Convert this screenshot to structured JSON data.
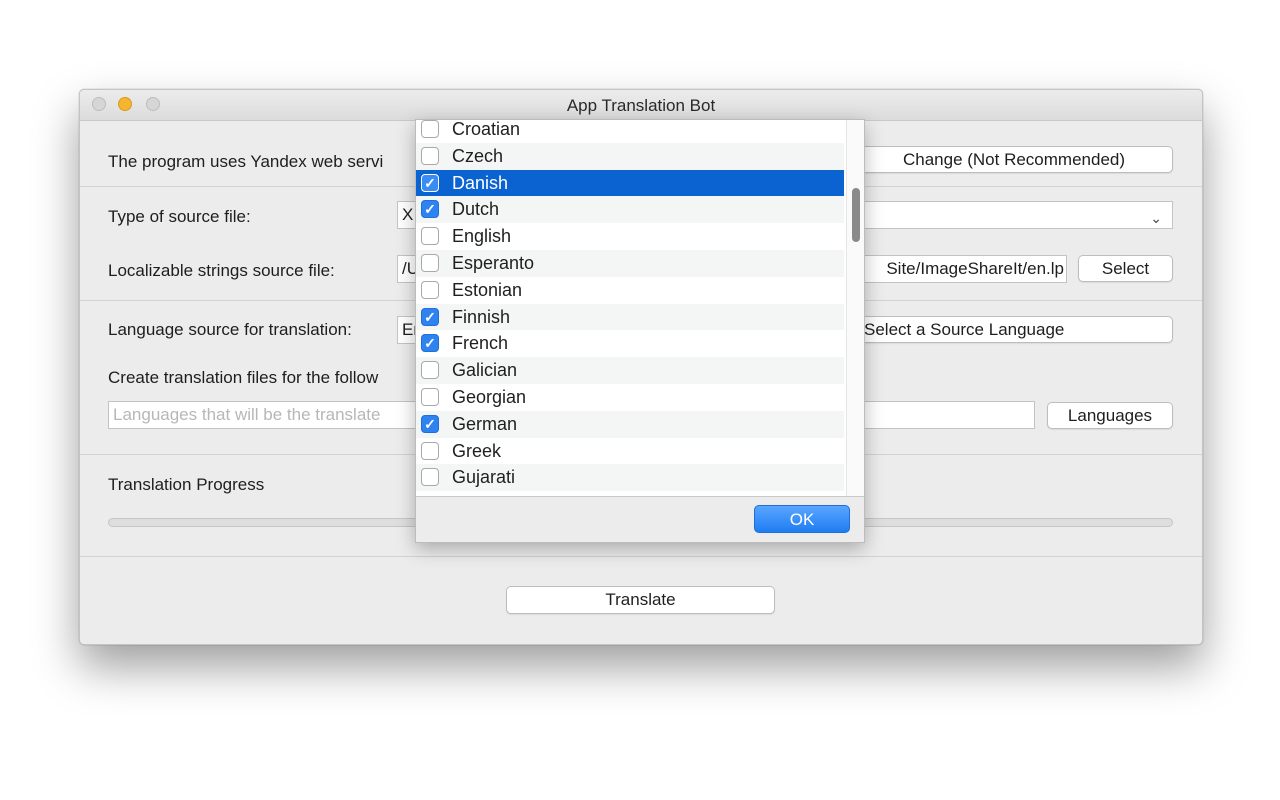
{
  "window": {
    "title": "App Translation Bot"
  },
  "service": {
    "text": "The program uses Yandex web servi",
    "change_button": "Change (Not Recommended)"
  },
  "source_type": {
    "label": "Type of source file:",
    "value": "X"
  },
  "strings_file": {
    "label": "Localizable strings source file:",
    "value_left": "/U",
    "value_right": "Site/ImageShareIt/en.lp",
    "select_button": "Select"
  },
  "language_source": {
    "label": "Language source for translation:",
    "value": "Er",
    "select_button": "Select a Source Language"
  },
  "targets": {
    "label": "Create translation files for the follow",
    "placeholder": "Languages that will be the translate",
    "languages_button": "Languages"
  },
  "progress": {
    "label": "Translation Progress",
    "value": 0
  },
  "translate_button": "Translate",
  "language_popup": {
    "ok_label": "OK",
    "items": [
      {
        "name": "Croatian",
        "checked": false,
        "selected": false
      },
      {
        "name": "Czech",
        "checked": false,
        "selected": false
      },
      {
        "name": "Danish",
        "checked": true,
        "selected": true
      },
      {
        "name": "Dutch",
        "checked": true,
        "selected": false
      },
      {
        "name": "English",
        "checked": false,
        "selected": false
      },
      {
        "name": "Esperanto",
        "checked": false,
        "selected": false
      },
      {
        "name": "Estonian",
        "checked": false,
        "selected": false
      },
      {
        "name": "Finnish",
        "checked": true,
        "selected": false
      },
      {
        "name": "French",
        "checked": true,
        "selected": false
      },
      {
        "name": "Galician",
        "checked": false,
        "selected": false
      },
      {
        "name": "Georgian",
        "checked": false,
        "selected": false
      },
      {
        "name": "German",
        "checked": true,
        "selected": false
      },
      {
        "name": "Greek",
        "checked": false,
        "selected": false
      },
      {
        "name": "Gujarati",
        "checked": false,
        "selected": false
      }
    ]
  }
}
